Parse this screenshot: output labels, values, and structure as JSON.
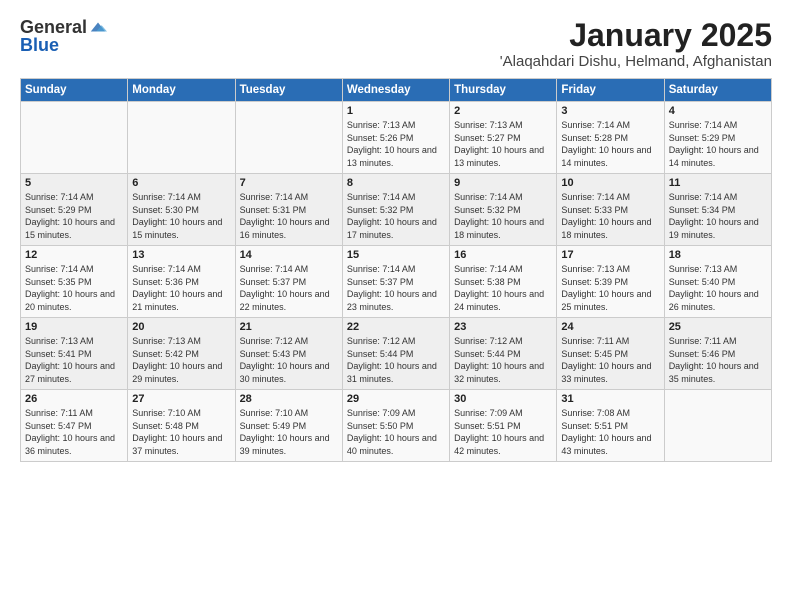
{
  "header": {
    "logo": {
      "general": "General",
      "blue": "Blue"
    },
    "title": "January 2025",
    "location": "'Alaqahdari Dishu, Helmand, Afghanistan"
  },
  "days_of_week": [
    "Sunday",
    "Monday",
    "Tuesday",
    "Wednesday",
    "Thursday",
    "Friday",
    "Saturday"
  ],
  "weeks": [
    [
      {
        "day": "",
        "info": ""
      },
      {
        "day": "",
        "info": ""
      },
      {
        "day": "",
        "info": ""
      },
      {
        "day": "1",
        "info": "Sunrise: 7:13 AM\nSunset: 5:26 PM\nDaylight: 10 hours\nand 13 minutes."
      },
      {
        "day": "2",
        "info": "Sunrise: 7:13 AM\nSunset: 5:27 PM\nDaylight: 10 hours\nand 13 minutes."
      },
      {
        "day": "3",
        "info": "Sunrise: 7:14 AM\nSunset: 5:28 PM\nDaylight: 10 hours\nand 14 minutes."
      },
      {
        "day": "4",
        "info": "Sunrise: 7:14 AM\nSunset: 5:29 PM\nDaylight: 10 hours\nand 14 minutes."
      }
    ],
    [
      {
        "day": "5",
        "info": "Sunrise: 7:14 AM\nSunset: 5:29 PM\nDaylight: 10 hours\nand 15 minutes."
      },
      {
        "day": "6",
        "info": "Sunrise: 7:14 AM\nSunset: 5:30 PM\nDaylight: 10 hours\nand 15 minutes."
      },
      {
        "day": "7",
        "info": "Sunrise: 7:14 AM\nSunset: 5:31 PM\nDaylight: 10 hours\nand 16 minutes."
      },
      {
        "day": "8",
        "info": "Sunrise: 7:14 AM\nSunset: 5:32 PM\nDaylight: 10 hours\nand 17 minutes."
      },
      {
        "day": "9",
        "info": "Sunrise: 7:14 AM\nSunset: 5:32 PM\nDaylight: 10 hours\nand 18 minutes."
      },
      {
        "day": "10",
        "info": "Sunrise: 7:14 AM\nSunset: 5:33 PM\nDaylight: 10 hours\nand 18 minutes."
      },
      {
        "day": "11",
        "info": "Sunrise: 7:14 AM\nSunset: 5:34 PM\nDaylight: 10 hours\nand 19 minutes."
      }
    ],
    [
      {
        "day": "12",
        "info": "Sunrise: 7:14 AM\nSunset: 5:35 PM\nDaylight: 10 hours\nand 20 minutes."
      },
      {
        "day": "13",
        "info": "Sunrise: 7:14 AM\nSunset: 5:36 PM\nDaylight: 10 hours\nand 21 minutes."
      },
      {
        "day": "14",
        "info": "Sunrise: 7:14 AM\nSunset: 5:37 PM\nDaylight: 10 hours\nand 22 minutes."
      },
      {
        "day": "15",
        "info": "Sunrise: 7:14 AM\nSunset: 5:37 PM\nDaylight: 10 hours\nand 23 minutes."
      },
      {
        "day": "16",
        "info": "Sunrise: 7:14 AM\nSunset: 5:38 PM\nDaylight: 10 hours\nand 24 minutes."
      },
      {
        "day": "17",
        "info": "Sunrise: 7:13 AM\nSunset: 5:39 PM\nDaylight: 10 hours\nand 25 minutes."
      },
      {
        "day": "18",
        "info": "Sunrise: 7:13 AM\nSunset: 5:40 PM\nDaylight: 10 hours\nand 26 minutes."
      }
    ],
    [
      {
        "day": "19",
        "info": "Sunrise: 7:13 AM\nSunset: 5:41 PM\nDaylight: 10 hours\nand 27 minutes."
      },
      {
        "day": "20",
        "info": "Sunrise: 7:13 AM\nSunset: 5:42 PM\nDaylight: 10 hours\nand 29 minutes."
      },
      {
        "day": "21",
        "info": "Sunrise: 7:12 AM\nSunset: 5:43 PM\nDaylight: 10 hours\nand 30 minutes."
      },
      {
        "day": "22",
        "info": "Sunrise: 7:12 AM\nSunset: 5:44 PM\nDaylight: 10 hours\nand 31 minutes."
      },
      {
        "day": "23",
        "info": "Sunrise: 7:12 AM\nSunset: 5:44 PM\nDaylight: 10 hours\nand 32 minutes."
      },
      {
        "day": "24",
        "info": "Sunrise: 7:11 AM\nSunset: 5:45 PM\nDaylight: 10 hours\nand 33 minutes."
      },
      {
        "day": "25",
        "info": "Sunrise: 7:11 AM\nSunset: 5:46 PM\nDaylight: 10 hours\nand 35 minutes."
      }
    ],
    [
      {
        "day": "26",
        "info": "Sunrise: 7:11 AM\nSunset: 5:47 PM\nDaylight: 10 hours\nand 36 minutes."
      },
      {
        "day": "27",
        "info": "Sunrise: 7:10 AM\nSunset: 5:48 PM\nDaylight: 10 hours\nand 37 minutes."
      },
      {
        "day": "28",
        "info": "Sunrise: 7:10 AM\nSunset: 5:49 PM\nDaylight: 10 hours\nand 39 minutes."
      },
      {
        "day": "29",
        "info": "Sunrise: 7:09 AM\nSunset: 5:50 PM\nDaylight: 10 hours\nand 40 minutes."
      },
      {
        "day": "30",
        "info": "Sunrise: 7:09 AM\nSunset: 5:51 PM\nDaylight: 10 hours\nand 42 minutes."
      },
      {
        "day": "31",
        "info": "Sunrise: 7:08 AM\nSunset: 5:51 PM\nDaylight: 10 hours\nand 43 minutes."
      },
      {
        "day": "",
        "info": ""
      }
    ]
  ]
}
